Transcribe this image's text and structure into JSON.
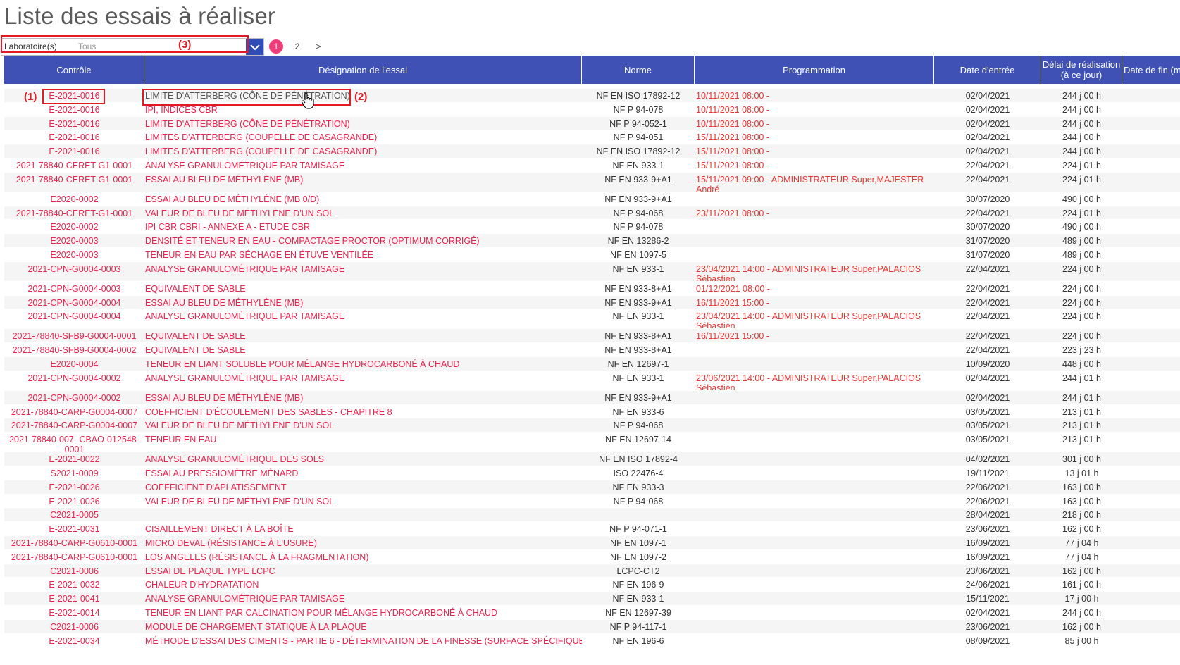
{
  "page": {
    "title": "Liste des essais à réaliser"
  },
  "filter": {
    "label": "Laboratoire(s)",
    "value": "Tous"
  },
  "pagination": {
    "pages": [
      "1",
      "2"
    ],
    "current": "1",
    "next": ">"
  },
  "annotations": {
    "a1": "(1)",
    "a2": "(2)",
    "a3": "(3)"
  },
  "colors": {
    "header_bg": "#3f51b5",
    "accent_pink": "#ee3e7a",
    "link_red": "#e8254f",
    "annotation_red": "#e01b24"
  },
  "table": {
    "columns": [
      "Contrôle",
      "Désignation de l'essai",
      "Norme",
      "Programmation",
      "Date d'entrée",
      "Délai de réalisation (à ce jour)",
      "Date de fin (m"
    ],
    "rows": [
      {
        "ctrl": "E-2021-0016",
        "des": "LIMITE D'ATTERBERG (CÔNE DE PÉNÉTRATION)",
        "norm": "NF EN ISO 17892-12",
        "prog": "10/11/2021 08:00 -",
        "date": "02/04/2021",
        "delai": "244 j 00 h"
      },
      {
        "ctrl": "E-2021-0016",
        "des": "IPI, INDICES CBR",
        "norm": "NF P 94-078",
        "prog": "10/11/2021 08:00 -",
        "date": "02/04/2021",
        "delai": "244 j 00 h"
      },
      {
        "ctrl": "E-2021-0016",
        "des": "LIMITE D'ATTERBERG (CÔNE DE PÉNÉTRATION)",
        "norm": "NF P 94-052-1",
        "prog": "10/11/2021 08:00 -",
        "date": "02/04/2021",
        "delai": "244 j 00 h"
      },
      {
        "ctrl": "E-2021-0016",
        "des": "LIMITES D'ATTERBERG (COUPELLE DE CASAGRANDE)",
        "norm": "NF P 94-051",
        "prog": "15/11/2021 08:00 -",
        "date": "02/04/2021",
        "delai": "244 j 00 h"
      },
      {
        "ctrl": "E-2021-0016",
        "des": "LIMITES D'ATTERBERG (COUPELLE DE CASAGRANDE)",
        "norm": "NF EN ISO 17892-12",
        "prog": "15/11/2021 08:00 -",
        "date": "02/04/2021",
        "delai": "244 j 00 h"
      },
      {
        "ctrl": "2021-78840-CERET-G1-0001",
        "des": "ANALYSE GRANULOMÉTRIQUE PAR TAMISAGE",
        "norm": "NF EN 933-1",
        "prog": "15/11/2021 08:00 -",
        "date": "22/04/2021",
        "delai": "224 j 01 h"
      },
      {
        "ctrl": "2021-78840-CERET-G1-0001",
        "des": "ESSAI AU BLEU DE MÉTHYLÈNE (MB)",
        "norm": "NF EN 933-9+A1",
        "prog": "15/11/2021 09:00 - ADMINISTRATEUR Super,MAJESTER André",
        "date": "22/04/2021",
        "delai": "224 j 01 h"
      },
      {
        "ctrl": "E2020-0002",
        "des": "ESSAI AU BLEU DE MÉTHYLÈNE (MB 0/D)",
        "norm": "NF EN 933-9+A1",
        "prog": "",
        "date": "30/07/2020",
        "delai": "490 j 00 h"
      },
      {
        "ctrl": "2021-78840-CERET-G1-0001",
        "des": "VALEUR DE BLEU DE MÉTHYLÈNE D'UN SOL",
        "norm": "NF P 94-068",
        "prog": "23/11/2021 08:00 -",
        "date": "22/04/2021",
        "delai": "224 j 01 h"
      },
      {
        "ctrl": "E2020-0002",
        "des": "IPI CBR CBRI - ANNEXE A - ETUDE CBR",
        "norm": "NF P 94-078",
        "prog": "",
        "date": "30/07/2020",
        "delai": "490 j 00 h"
      },
      {
        "ctrl": "E2020-0003",
        "des": "DENSITÉ ET TENEUR EN EAU - COMPACTAGE PROCTOR (OPTIMUM CORRIGÉ)",
        "norm": "NF EN 13286-2",
        "prog": "",
        "date": "31/07/2020",
        "delai": "489 j 00 h"
      },
      {
        "ctrl": "E2020-0003",
        "des": "TENEUR EN EAU PAR SÉCHAGE EN ÉTUVE VENTILÉE",
        "norm": "NF EN 1097-5",
        "prog": "",
        "date": "31/07/2020",
        "delai": "489 j 00 h"
      },
      {
        "ctrl": "2021-CPN-G0004-0003",
        "des": "ANALYSE GRANULOMÉTRIQUE PAR TAMISAGE",
        "norm": "NF EN 933-1",
        "prog": "23/04/2021 14:00 - ADMINISTRATEUR Super,PALACIOS Sébastien",
        "date": "22/04/2021",
        "delai": "224 j 00 h"
      },
      {
        "ctrl": "2021-CPN-G0004-0003",
        "des": "EQUIVALENT DE SABLE",
        "norm": "NF EN 933-8+A1",
        "prog": "01/12/2021 08:00 -",
        "date": "22/04/2021",
        "delai": "224 j 00 h"
      },
      {
        "ctrl": "2021-CPN-G0004-0004",
        "des": "ESSAI AU BLEU DE MÉTHYLÈNE (MB)",
        "norm": "NF EN 933-9+A1",
        "prog": "16/11/2021 15:00 -",
        "date": "22/04/2021",
        "delai": "224 j 00 h"
      },
      {
        "ctrl": "2021-CPN-G0004-0004",
        "des": "ANALYSE GRANULOMÉTRIQUE PAR TAMISAGE",
        "norm": "NF EN 933-1",
        "prog": "23/04/2021 14:00 - ADMINISTRATEUR Super,PALACIOS Sébastien",
        "date": "22/04/2021",
        "delai": "224 j 00 h"
      },
      {
        "ctrl": "2021-78840-SFB9-G0004-0001",
        "des": "EQUIVALENT DE SABLE",
        "norm": "NF EN 933-8+A1",
        "prog": "16/11/2021 15:00 -",
        "date": "22/04/2021",
        "delai": "224 j 00 h"
      },
      {
        "ctrl": "2021-78840-SFB9-G0004-0002",
        "des": "EQUIVALENT DE SABLE",
        "norm": "NF EN 933-8+A1",
        "prog": "",
        "date": "22/04/2021",
        "delai": "223 j 23 h"
      },
      {
        "ctrl": "E2020-0004",
        "des": "TENEUR EN LIANT SOLUBLE POUR MÉLANGE HYDROCARBONÉ À CHAUD",
        "norm": "NF EN 12697-1",
        "prog": "",
        "date": "10/09/2020",
        "delai": "448 j 00 h"
      },
      {
        "ctrl": "2021-CPN-G0004-0002",
        "des": "ANALYSE GRANULOMÉTRIQUE PAR TAMISAGE",
        "norm": "NF EN 933-1",
        "prog": "23/06/2021 14:00 - ADMINISTRATEUR Super,PALACIOS Sébastien",
        "date": "02/04/2021",
        "delai": "244 j 01 h"
      },
      {
        "ctrl": "2021-CPN-G0004-0002",
        "des": "ESSAI AU BLEU DE MÉTHYLÈNE (MB)",
        "norm": "NF EN 933-9+A1",
        "prog": "",
        "date": "02/04/2021",
        "delai": "244 j 01 h"
      },
      {
        "ctrl": "2021-78840-CARP-G0004-0007",
        "des": "COEFFICIENT D'ÉCOULEMENT DES SABLES - CHAPITRE 8",
        "norm": "NF EN 933-6",
        "prog": "",
        "date": "03/05/2021",
        "delai": "213 j 01 h"
      },
      {
        "ctrl": "2021-78840-CARP-G0004-0007",
        "des": "VALEUR DE BLEU DE MÉTHYLÈNE D'UN SOL",
        "norm": "NF P 94-068",
        "prog": "",
        "date": "03/05/2021",
        "delai": "213 j 01 h"
      },
      {
        "ctrl": "2021-78840-007- CBAO-012548-0001",
        "des": "TENEUR EN EAU",
        "norm": "NF EN 12697-14",
        "prog": "",
        "date": "03/05/2021",
        "delai": "213 j 01 h"
      },
      {
        "ctrl": "E-2021-0022",
        "des": "ANALYSE GRANULOMÉTRIQUE DES SOLS",
        "norm": "NF EN ISO 17892-4",
        "prog": "",
        "date": "04/02/2021",
        "delai": "301 j 00 h"
      },
      {
        "ctrl": "S2021-0009",
        "des": "ESSAI AU PRESSIOMÈTRE MÉNARD",
        "norm": "ISO 22476-4",
        "prog": "",
        "date": "19/11/2021",
        "delai": "13 j 01 h"
      },
      {
        "ctrl": "E-2021-0026",
        "des": "COEFFICIENT D'APLATISSEMENT",
        "norm": "NF EN 933-3",
        "prog": "",
        "date": "22/06/2021",
        "delai": "163 j 00 h"
      },
      {
        "ctrl": "E-2021-0026",
        "des": "VALEUR DE BLEU DE MÉTHYLÈNE D'UN SOL",
        "norm": "NF P 94-068",
        "prog": "",
        "date": "22/06/2021",
        "delai": "163 j 00 h"
      },
      {
        "ctrl": "C2021-0005",
        "des": "",
        "norm": "",
        "prog": "",
        "date": "28/04/2021",
        "delai": "218 j 00 h"
      },
      {
        "ctrl": "E-2021-0031",
        "des": "CISAILLEMENT DIRECT À LA BOÎTE",
        "norm": "NF P 94-071-1",
        "prog": "",
        "date": "23/06/2021",
        "delai": "162 j 00 h"
      },
      {
        "ctrl": "2021-78840-CARP-G0610-0001",
        "des": "MICRO DEVAL (RÉSISTANCE À L'USURE)",
        "norm": "NF EN 1097-1",
        "prog": "",
        "date": "16/09/2021",
        "delai": "77 j 04 h"
      },
      {
        "ctrl": "2021-78840-CARP-G0610-0001",
        "des": "LOS ANGELES (RÉSISTANCE À LA FRAGMENTATION)",
        "norm": "NF EN 1097-2",
        "prog": "",
        "date": "16/09/2021",
        "delai": "77 j 04 h"
      },
      {
        "ctrl": "C2021-0006",
        "des": "ESSAI DE PLAQUE TYPE LCPC",
        "norm": "LCPC-CT2",
        "prog": "",
        "date": "23/06/2021",
        "delai": "162 j 00 h"
      },
      {
        "ctrl": "E-2021-0032",
        "des": "CHALEUR D'HYDRATATION",
        "norm": "NF EN 196-9",
        "prog": "",
        "date": "24/06/2021",
        "delai": "161 j 00 h"
      },
      {
        "ctrl": "E-2021-0041",
        "des": "ANALYSE GRANULOMÉTRIQUE PAR TAMISAGE",
        "norm": "NF EN 933-1",
        "prog": "",
        "date": "15/11/2021",
        "delai": "17 j 00 h"
      },
      {
        "ctrl": "E-2021-0014",
        "des": "TENEUR EN LIANT PAR CALCINATION POUR MÉLANGE HYDROCARBONÉ À CHAUD",
        "norm": "NF EN 12697-39",
        "prog": "",
        "date": "02/04/2021",
        "delai": "244 j 00 h"
      },
      {
        "ctrl": "C2021-0006",
        "des": "MODULE DE CHARGEMENT STATIQUE À LA PLAQUE",
        "norm": "NF P 94-117-1",
        "prog": "",
        "date": "23/06/2021",
        "delai": "162 j 00 h"
      },
      {
        "ctrl": "E-2021-0034",
        "des": "MÉTHODE D'ESSAI DES CIMENTS - PARTIE 6 - DÉTERMINATION DE LA FINESSE (SURFACE SPÉCIFIQUE BLAINE)",
        "norm": "NF EN 196-6",
        "prog": "",
        "date": "08/09/2021",
        "delai": "85 j 00 h"
      }
    ]
  }
}
